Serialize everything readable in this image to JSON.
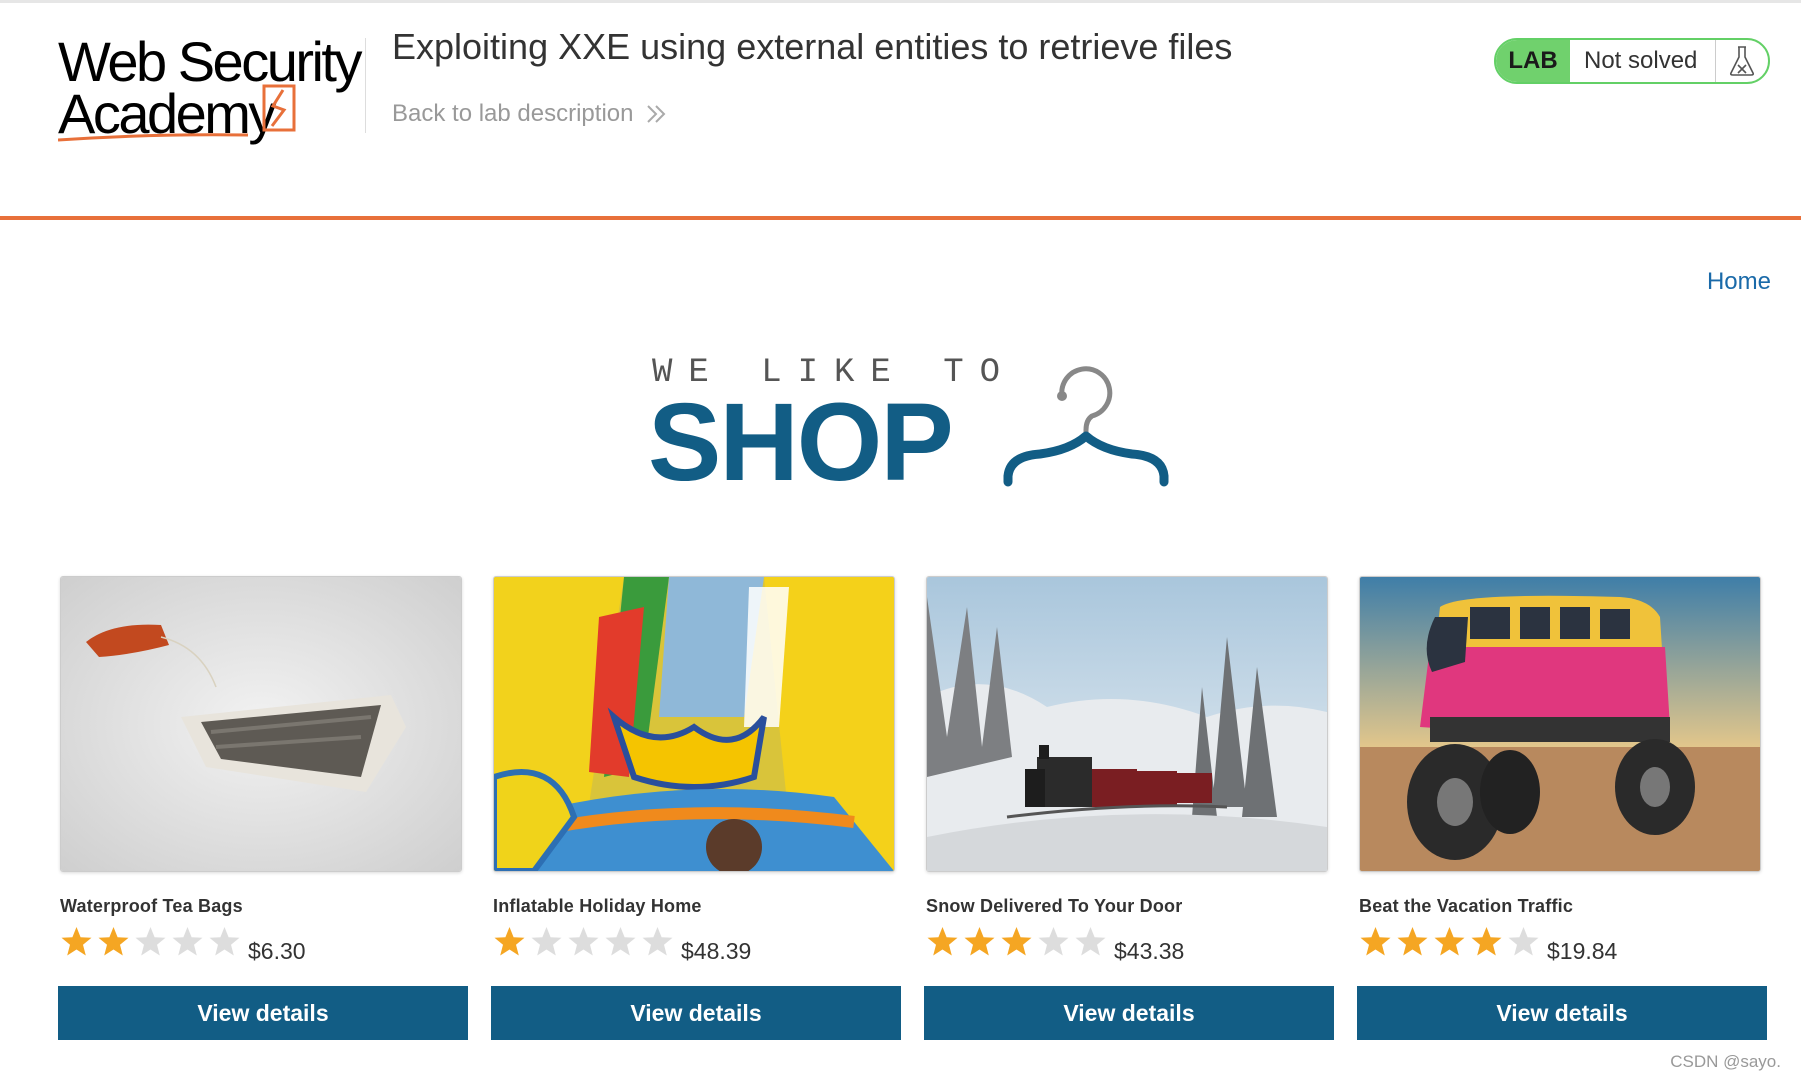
{
  "header": {
    "logo_line1": "Web Security",
    "logo_line2": "Academy",
    "lab_title": "Exploiting XXE using external entities to retrieve files",
    "back_link": "Back to lab description",
    "status_badge": "LAB",
    "status_text": "Not solved"
  },
  "nav": {
    "home": "Home"
  },
  "banner": {
    "tagline": "WE LIKE TO",
    "word": "SHOP"
  },
  "products": [
    {
      "name": "Waterproof Tea Bags",
      "rating": 2,
      "max_rating": 5,
      "price": "$6.30",
      "button": "View details"
    },
    {
      "name": "Inflatable Holiday Home",
      "rating": 1,
      "max_rating": 5,
      "price": "$48.39",
      "button": "View details"
    },
    {
      "name": "Snow Delivered To Your Door",
      "rating": 3,
      "max_rating": 5,
      "price": "$43.38",
      "button": "View details"
    },
    {
      "name": "Beat the Vacation Traffic",
      "rating": 4,
      "max_rating": 5,
      "price": "$19.84",
      "button": "View details"
    }
  ],
  "colors": {
    "primary": "#125d85",
    "accent_orange": "#e8703a",
    "lab_green": "#70d16d",
    "star_gold": "#f5a623",
    "star_empty": "#dddddd"
  },
  "watermark": "CSDN @sayo."
}
